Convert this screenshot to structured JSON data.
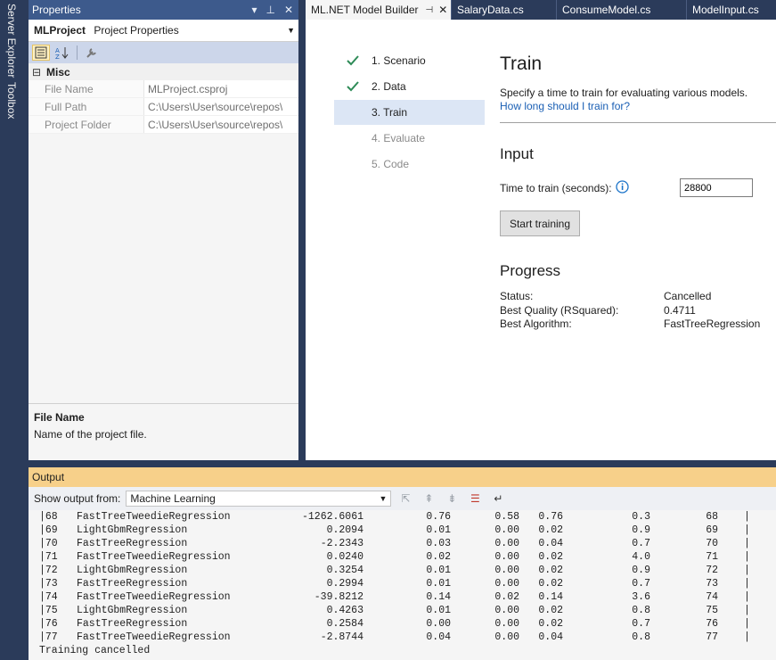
{
  "side_tabs": [
    "Server Explorer",
    "Toolbox"
  ],
  "properties": {
    "title": "Properties",
    "object_name": "MLProject",
    "object_type": "Project Properties",
    "category": "Misc",
    "rows": [
      {
        "name": "File Name",
        "value": "MLProject.csproj"
      },
      {
        "name": "Full Path",
        "value": "C:\\Users\\User\\source\\repos\\"
      },
      {
        "name": "Project Folder",
        "value": "C:\\Users\\User\\source\\repos\\"
      }
    ],
    "desc_title": "File Name",
    "desc_text": "Name of the project file."
  },
  "doc_tabs": [
    {
      "label": "ML.NET Model Builder",
      "active": true
    },
    {
      "label": "SalaryData.cs"
    },
    {
      "label": "ConsumeModel.cs"
    },
    {
      "label": "ModelInput.cs"
    }
  ],
  "steps": [
    {
      "label": "1. Scenario",
      "state": "done"
    },
    {
      "label": "2. Data",
      "state": "done"
    },
    {
      "label": "3. Train",
      "state": "current"
    },
    {
      "label": "4. Evaluate",
      "state": "future"
    },
    {
      "label": "5. Code",
      "state": "future"
    }
  ],
  "train": {
    "heading": "Train",
    "description": "Specify a time to train for evaluating various models.",
    "help_link": "How long should I train for?",
    "input_heading": "Input",
    "time_label": "Time to train (seconds):",
    "time_value": "28800",
    "start_button": "Start training",
    "progress_heading": "Progress",
    "status_label": "Status:",
    "status_value": "Cancelled",
    "quality_label": "Best Quality (RSquared):",
    "quality_value": "0.4711",
    "algorithm_label": "Best Algorithm:",
    "algorithm_value": "FastTreeRegression"
  },
  "output": {
    "title": "Output",
    "show_from_label": "Show output from:",
    "source": "Machine Learning",
    "rows": [
      {
        "idx": "|68",
        "trainer": "FastTreeTweedieRegression",
        "rsq": "-1262.6061",
        "abs": "0.76",
        "rms": "0.58",
        "loss": "0.76",
        "dur": "0.3",
        "num": "68"
      },
      {
        "idx": "|69",
        "trainer": "LightGbmRegression",
        "rsq": "0.2094",
        "abs": "0.01",
        "rms": "0.00",
        "loss": "0.02",
        "dur": "0.9",
        "num": "69"
      },
      {
        "idx": "|70",
        "trainer": "FastTreeRegression",
        "rsq": "-2.2343",
        "abs": "0.03",
        "rms": "0.00",
        "loss": "0.04",
        "dur": "0.7",
        "num": "70"
      },
      {
        "idx": "|71",
        "trainer": "FastTreeTweedieRegression",
        "rsq": "0.0240",
        "abs": "0.02",
        "rms": "0.00",
        "loss": "0.02",
        "dur": "4.0",
        "num": "71"
      },
      {
        "idx": "|72",
        "trainer": "LightGbmRegression",
        "rsq": "0.3254",
        "abs": "0.01",
        "rms": "0.00",
        "loss": "0.02",
        "dur": "0.9",
        "num": "72"
      },
      {
        "idx": "|73",
        "trainer": "FastTreeRegression",
        "rsq": "0.2994",
        "abs": "0.01",
        "rms": "0.00",
        "loss": "0.02",
        "dur": "0.7",
        "num": "73"
      },
      {
        "idx": "|74",
        "trainer": "FastTreeTweedieRegression",
        "rsq": "-39.8212",
        "abs": "0.14",
        "rms": "0.02",
        "loss": "0.14",
        "dur": "3.6",
        "num": "74"
      },
      {
        "idx": "|75",
        "trainer": "LightGbmRegression",
        "rsq": "0.4263",
        "abs": "0.01",
        "rms": "0.00",
        "loss": "0.02",
        "dur": "0.8",
        "num": "75"
      },
      {
        "idx": "|76",
        "trainer": "FastTreeRegression",
        "rsq": "0.2584",
        "abs": "0.00",
        "rms": "0.00",
        "loss": "0.02",
        "dur": "0.7",
        "num": "76"
      },
      {
        "idx": "|77",
        "trainer": "FastTreeTweedieRegression",
        "rsq": "-2.8744",
        "abs": "0.04",
        "rms": "0.00",
        "loss": "0.04",
        "dur": "0.8",
        "num": "77"
      }
    ],
    "final_line": "Training cancelled"
  },
  "colors": {
    "title_bar": "#3d5a8c",
    "output_title": "#f7d08a",
    "check": "#2e8b57",
    "link": "#1a5fb4",
    "info_icon": "#1a73c9"
  }
}
